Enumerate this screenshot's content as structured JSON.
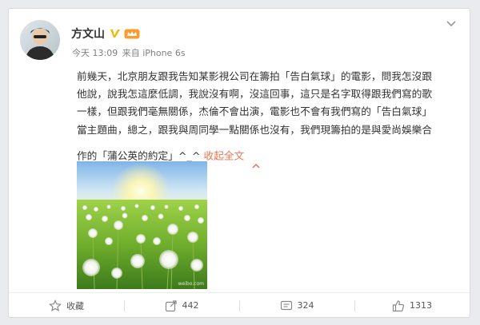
{
  "post": {
    "author": "方文山",
    "time": "今天 13:09",
    "source": "来自 iPhone 6s",
    "text": "前幾天，北京朋友跟我告知某影視公司在籌拍「告白氣球」的電影，問我怎沒跟他說，說我怎這麼低調，我說沒有啊，沒這回事，這只是名字取得跟我們寫的歌一樣，但跟我們毫無關係，杰倫不會出演，電影也不會有我們寫的「告白氣球」當主題曲，總之，跟我與周同學一點關係也沒有，我們現籌拍的是與愛尚娛樂合作的「蒲公英的約定」^_^ ",
    "collapse_label": "收起全文",
    "image_watermark": "weibo.com"
  },
  "actions": {
    "favorite_label": "收藏",
    "repost_count": "442",
    "comment_count": "324",
    "like_count": "1313"
  },
  "colors": {
    "accent": "#eb7350",
    "verified": "#f7b500",
    "text": "#333333"
  },
  "icons": {
    "menu": "chevron-down-icon",
    "verified": "verified-v-icon",
    "vip": "vip-crown-icon",
    "favorite": "star-icon",
    "repost": "repost-icon",
    "comment": "comment-icon",
    "like": "thumbs-up-icon"
  }
}
